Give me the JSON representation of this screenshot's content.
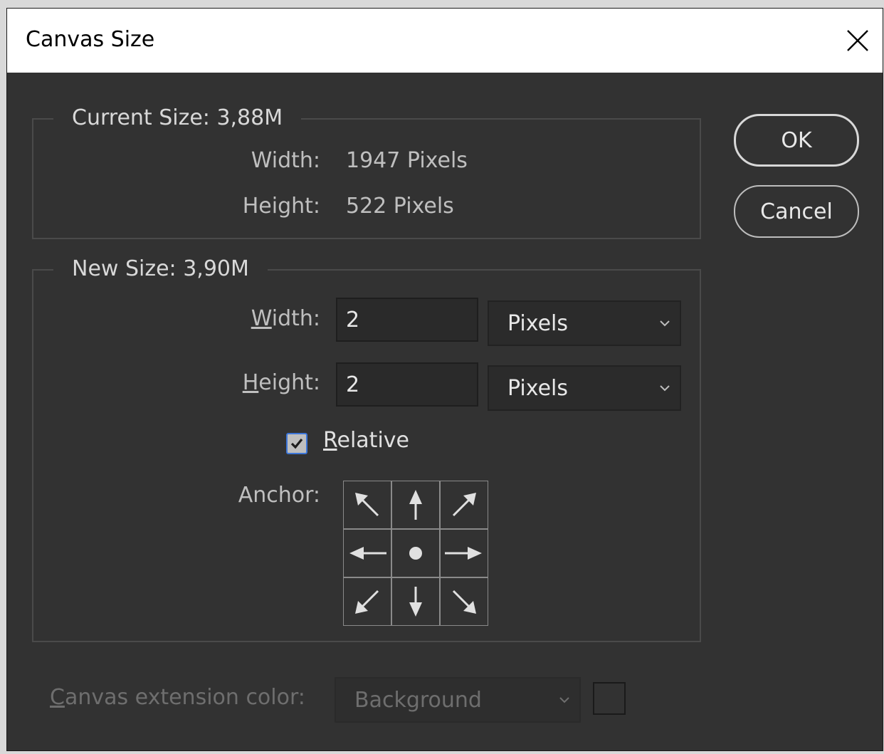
{
  "window": {
    "title": "Canvas Size"
  },
  "current_size": {
    "legend": "Current Size: 3,88M",
    "width_label": "Width:",
    "width_value": "1947 Pixels",
    "height_label": "Height:",
    "height_value": "522 Pixels"
  },
  "new_size": {
    "legend": "New Size: 3,90M",
    "width_label_u": "W",
    "width_label_rest": "idth:",
    "width_value": "2",
    "width_unit": "Pixels",
    "height_label_u": "H",
    "height_label_rest": "eight:",
    "height_value": "2",
    "height_unit": "Pixels",
    "relative_label_u": "R",
    "relative_label_rest": "elative",
    "relative_checked": true,
    "anchor_label": "Anchor:"
  },
  "buttons": {
    "ok": "OK",
    "cancel": "Cancel"
  },
  "extension": {
    "label_u": "C",
    "label_rest": "anvas extension color:",
    "value": "Background"
  },
  "icons": {
    "close": "close-icon",
    "chevron": "chevron-down-icon",
    "check": "checkmark-icon",
    "anchor": [
      "arrow-up-left-icon",
      "arrow-up-icon",
      "arrow-up-right-icon",
      "arrow-left-icon",
      "anchor-center-dot-icon",
      "arrow-right-icon",
      "arrow-down-left-icon",
      "arrow-down-icon",
      "arrow-down-right-icon"
    ]
  },
  "colors": {
    "dialog_bg": "#323232",
    "titlebar_bg": "#ffffff",
    "accent": "#3d76d8"
  }
}
